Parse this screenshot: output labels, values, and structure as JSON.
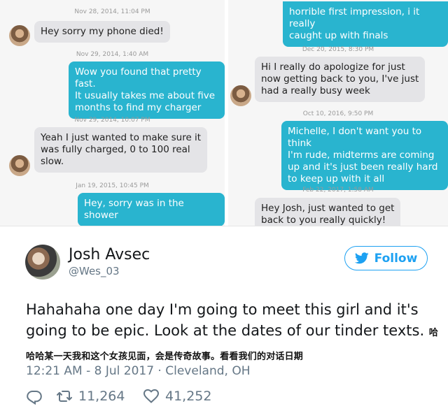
{
  "left_panel": {
    "items": [
      {
        "type": "timestamp",
        "text": "Nov 28, 2014, 11:04 PM"
      },
      {
        "type": "received",
        "text": "Hey sorry my phone died!"
      },
      {
        "type": "timestamp",
        "text": "Nov 29, 2014, 1:40 AM"
      },
      {
        "type": "sent",
        "text": "Wow you found that pretty fast.\nIt usually takes me about  five\nmonths to find my charger"
      },
      {
        "type": "timestamp",
        "text": "Nov 29, 2014, 10:07 PM"
      },
      {
        "type": "received",
        "text": "Yeah I just wanted to make sure it\nwas fully charged, 0 to 100 real\nslow."
      },
      {
        "type": "timestamp",
        "text": "Jan 19, 2015, 10:45 PM"
      },
      {
        "type": "sent",
        "text": "Hey, sorry was in the shower"
      }
    ]
  },
  "right_panel": {
    "items": [
      {
        "type": "sent",
        "text": "horrible first impression, i it really\ncaught up with finals"
      },
      {
        "type": "timestamp",
        "text": "Dec 20, 2015, 8:30 PM"
      },
      {
        "type": "received",
        "text": "Hi I really do apologize for just\nnow getting back to you, I've just\nhad a really busy week"
      },
      {
        "type": "timestamp",
        "text": "Oct 10, 2016, 9:50 PM"
      },
      {
        "type": "sent",
        "text": "Michelle, I don't want you to think\nI'm rude, midterms are coming\nup and it's just been really hard\nto keep up with it all"
      },
      {
        "type": "timestamp",
        "text": "Feb 22, 2017, 1:58 AM"
      },
      {
        "type": "received",
        "text": "Hey Josh, just wanted to get\nback to you really quickly!"
      }
    ]
  },
  "tweet": {
    "display_name": "Josh Avsec",
    "handle": "@Wes_03",
    "follow_label": "Follow",
    "text": "Hahahaha one day I'm going to meet this girl and it's going to be epic. Look at the dates of our tinder texts.",
    "translation": "哈哈哈某一天我和这个女孩见面，会是传奇故事。看看我们的对话日期",
    "meta": "12:21 AM - 8 Jul 2017 · Cleveland, OH",
    "retweets": "11,264",
    "likes": "41,252",
    "icons": {
      "reply": "reply-icon",
      "retweet": "retweet-icon",
      "like": "heart-icon",
      "brand": "twitter-bird-icon"
    },
    "colors": {
      "accent": "#1da1f2",
      "sent_bubble": "#29b4cf",
      "received_bubble": "#e4e4e7"
    }
  }
}
